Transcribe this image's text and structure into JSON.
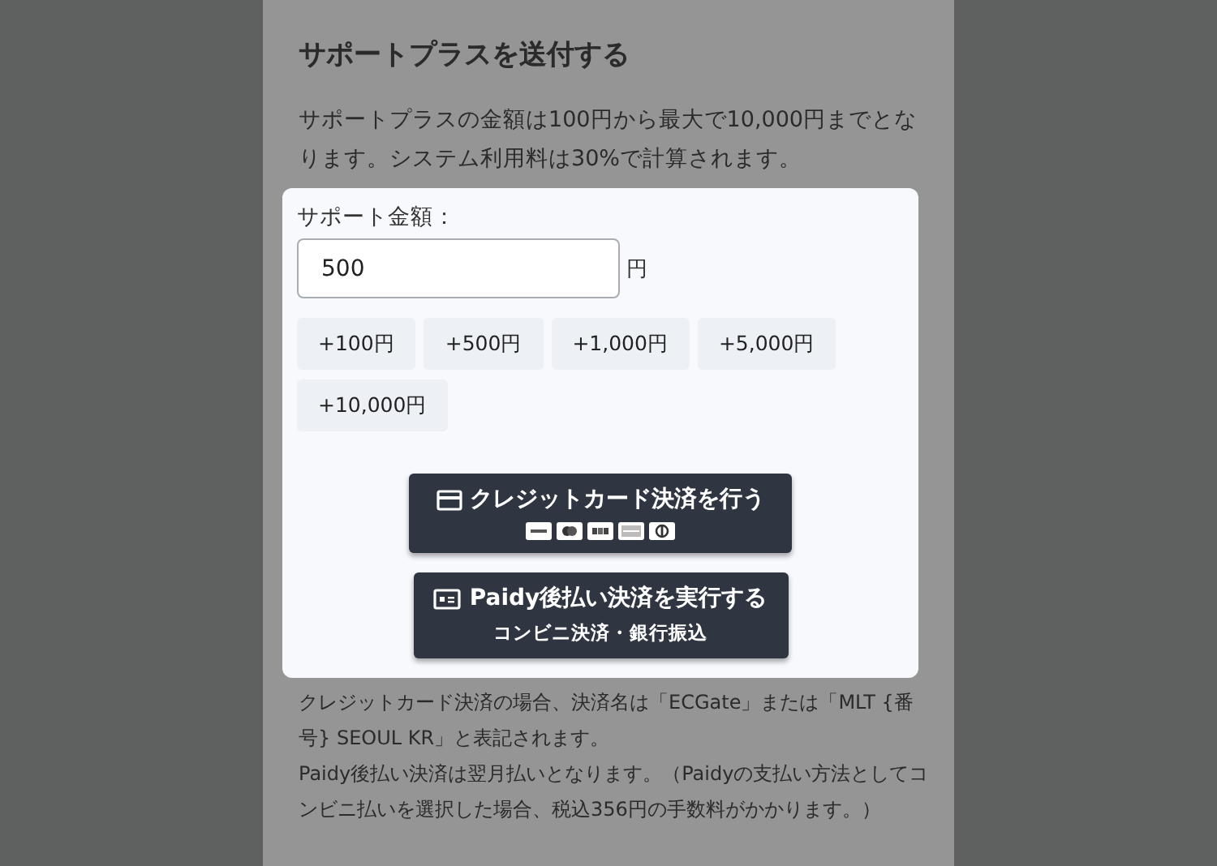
{
  "title": "サポートプラスを送付する",
  "intro": "サポートプラスの金額は100円から最大で10,000円までとなります。システム利用料は30%で計算されます。",
  "amount": {
    "label": "サポート金額：",
    "value": "500",
    "unit": "円"
  },
  "quick_buttons": [
    "+100円",
    "+500円",
    "+1,000円",
    "+5,000円",
    "+10,000円"
  ],
  "payment_buttons": [
    {
      "kind": "card",
      "label": "クレジットカード決済を行う"
    },
    {
      "kind": "paidy",
      "label": "Paidy後払い決済を実行する",
      "sublabel": "コンビニ決済・銀行振込"
    }
  ],
  "notes": [
    "クレジットカード決済の場合、決済名は「ECGate」または「MLT {番号} SEOUL KR」と表記されます。",
    "Paidy後払い決済は翌月払いとなります。（Paidyの支払い方法としてコンビニ払いを選択した場合、税込356円の手数料がかかります。）"
  ]
}
